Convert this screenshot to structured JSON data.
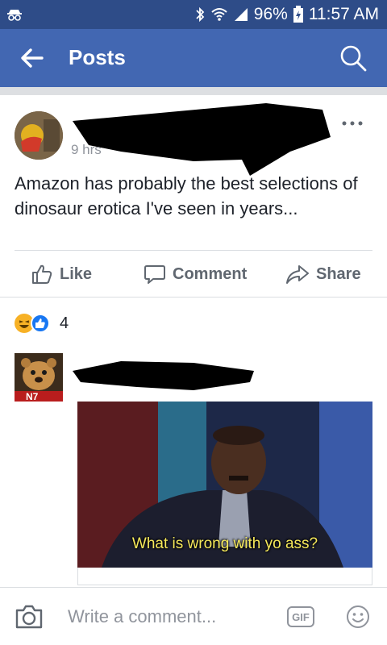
{
  "status_bar": {
    "battery": "96%",
    "time": "11:57 AM",
    "icons": [
      "incognito-icon",
      "bluetooth-icon",
      "wifi-icon",
      "signal-icon",
      "battery-charging-icon"
    ]
  },
  "app_bar": {
    "title": "Posts",
    "back_icon": "back-arrow-icon",
    "search_icon": "search-icon"
  },
  "post": {
    "time": "9 hrs",
    "text": "Amazon has probably the best selections of dinosaur erotica I've seen in years...",
    "more_icon": "more-options-icon"
  },
  "actions": {
    "like_label": "Like",
    "comment_label": "Comment",
    "share_label": "Share"
  },
  "reactions": {
    "count": "4",
    "types": [
      "haha-icon",
      "like-icon"
    ]
  },
  "comment": {
    "avatar_badge": "N7",
    "meme_caption": "What is wrong with yo ass?"
  },
  "composer": {
    "placeholder": "Write a comment...",
    "gif_label": "GIF",
    "camera_icon": "camera-icon",
    "emoji_icon": "emoji-icon"
  },
  "colors": {
    "status_bar": "#2e4c88",
    "app_bar": "#4267b2",
    "action_text": "#606770",
    "meta_text": "#90949c"
  }
}
